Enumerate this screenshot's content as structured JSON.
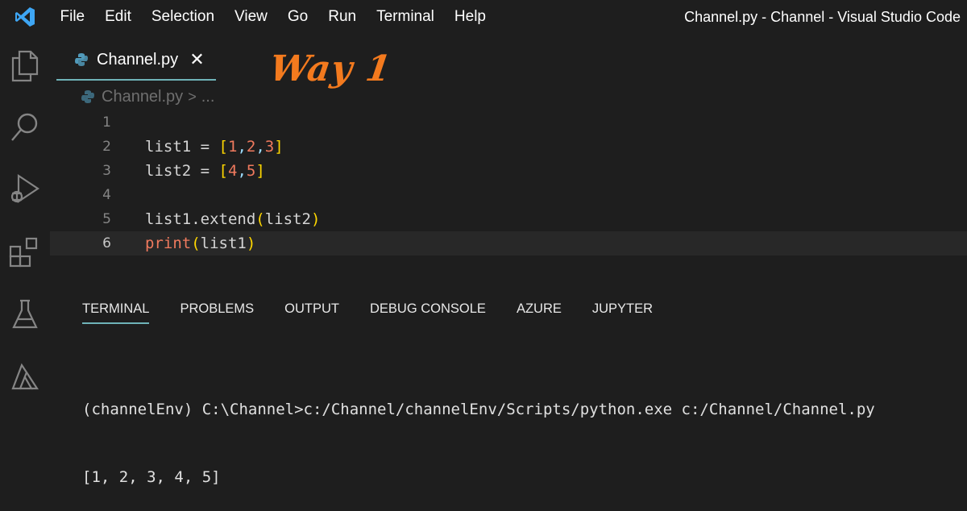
{
  "window": {
    "title": "Channel.py - Channel - Visual Studio Code"
  },
  "menu": [
    "File",
    "Edit",
    "Selection",
    "View",
    "Go",
    "Run",
    "Terminal",
    "Help"
  ],
  "activity_icons": [
    "explorer-icon",
    "search-icon",
    "run-debug-icon",
    "extensions-icon",
    "testing-flask-icon",
    "azure-icon"
  ],
  "tab": {
    "label": "Channel.py",
    "close": "✕"
  },
  "annotation": "Way 1",
  "breadcrumb": {
    "file": "Channel.py",
    "sep": ">",
    "more": "..."
  },
  "editor": {
    "line_numbers": [
      "1",
      "2",
      "3",
      "4",
      "5",
      "6"
    ],
    "lines": [
      [],
      [
        [
          "list1",
          "t-eq"
        ],
        [
          " = ",
          "t-eq"
        ],
        [
          "[",
          "t-br"
        ],
        [
          "1",
          "t-num"
        ],
        [
          ",",
          "t-comma"
        ],
        [
          "2",
          "t-num"
        ],
        [
          ",",
          "t-comma"
        ],
        [
          "3",
          "t-num"
        ],
        [
          "]",
          "t-br"
        ]
      ],
      [
        [
          "list2",
          "t-eq"
        ],
        [
          " = ",
          "t-eq"
        ],
        [
          "[",
          "t-br"
        ],
        [
          "4",
          "t-num"
        ],
        [
          ",",
          "t-comma"
        ],
        [
          "5",
          "t-num"
        ],
        [
          "]",
          "t-br"
        ]
      ],
      [],
      [
        [
          "list1.extend",
          "t-eq"
        ],
        [
          "(",
          "t-br"
        ],
        [
          "list2",
          "t-eq"
        ],
        [
          ")",
          "t-br"
        ]
      ],
      [
        [
          "print",
          "t-fn"
        ],
        [
          "(",
          "t-br"
        ],
        [
          "list1",
          "t-eq"
        ],
        [
          ")",
          "t-br"
        ]
      ]
    ]
  },
  "panel": {
    "tabs": [
      "TERMINAL",
      "PROBLEMS",
      "OUTPUT",
      "DEBUG CONSOLE",
      "AZURE",
      "JUPYTER"
    ],
    "terminal_lines": [
      "(channelEnv) C:\\Channel>c:/Channel/channelEnv/Scripts/python.exe c:/Channel/Channel.py",
      "[1, 2, 3, 4, 5]"
    ]
  },
  "colors": {
    "accent": "#6fb3b8",
    "annotation": "#f37a1e",
    "vscode_blue": "#3ea6f4",
    "python_icon": "#519aba"
  }
}
